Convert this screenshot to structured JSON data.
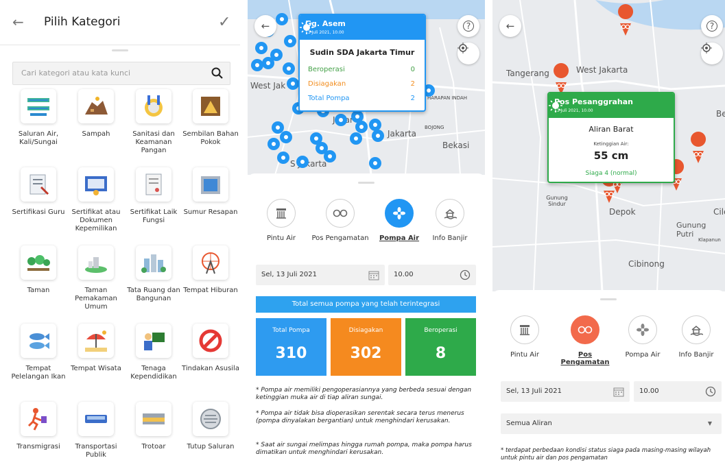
{
  "panel1": {
    "title": "Pilih Kategori",
    "search_placeholder": "Cari kategori atau kata kunci",
    "categories": [
      {
        "label": "Saluran Air, Kali/Sungai",
        "icon": "canal-icon"
      },
      {
        "label": "Sampah",
        "icon": "garbage-pile-icon"
      },
      {
        "label": "Sanitasi dan Keamanan Pangan",
        "icon": "food-safety-icon"
      },
      {
        "label": "Sembilan Bahan Pokok",
        "icon": "staple-food-icon"
      },
      {
        "label": "Sertifikasi Guru",
        "icon": "teacher-certificate-icon"
      },
      {
        "label": "Sertifikat atau Dokumen Kepemilikan",
        "icon": "ownership-certificate-icon"
      },
      {
        "label": "Sertifikat Laik Fungsi",
        "icon": "function-certificate-icon"
      },
      {
        "label": "Sumur Resapan",
        "icon": "infiltration-well-icon"
      },
      {
        "label": "Taman",
        "icon": "park-icon"
      },
      {
        "label": "Taman Pemakaman Umum",
        "icon": "cemetery-icon"
      },
      {
        "label": "Tata Ruang dan Bangunan",
        "icon": "city-planning-icon"
      },
      {
        "label": "Tempat Hiburan",
        "icon": "ferris-wheel-icon"
      },
      {
        "label": "Tempat Pelelangan Ikan",
        "icon": "fish-auction-icon"
      },
      {
        "label": "Tempat Wisata",
        "icon": "beach-umbrella-icon"
      },
      {
        "label": "Tenaga Kependidikan",
        "icon": "educator-icon"
      },
      {
        "label": "Tindakan Asusila",
        "icon": "prohibited-icon"
      },
      {
        "label": "Transmigrasi",
        "icon": "migration-icon"
      },
      {
        "label": "Transportasi Publik",
        "icon": "bus-icon"
      },
      {
        "label": "Trotoar",
        "icon": "sidewalk-icon"
      },
      {
        "label": "Tutup Saluran",
        "icon": "drain-cover-icon"
      }
    ]
  },
  "panel2": {
    "popup": {
      "location": "Gg. Asem",
      "datetime": "13 Juli 2021, 10.00",
      "agency": "Sudin SDA Jakarta Timur",
      "rows": [
        {
          "label": "Beroperasi",
          "value": "0",
          "color": "#43a047"
        },
        {
          "label": "Disiagakan",
          "value": "2",
          "color": "#f28c1c"
        },
        {
          "label": "Total Pompa",
          "value": "2",
          "color": "#2196f3"
        }
      ]
    },
    "map_labels": {
      "west": "West Jak",
      "harapan": "HARAPAN INDAH",
      "bojong": "BOJONG",
      "jakarta": "Jakar",
      "ejakarta": "Jakarta",
      "bekasi": "Bekasi",
      "south": "S  Jakarta"
    },
    "tabs": [
      "Pintu Air",
      "Pos Pengamatan",
      "Pompa Air",
      "Info Banjir"
    ],
    "active_tab": "Pompa Air",
    "date": "Sel, 13 Juli 2021",
    "time": "10.00",
    "banner": "Total semua pompa yang telah terintegrasi",
    "stats": [
      {
        "title": "Total Pompa",
        "value": "310",
        "color": "#2e9bf0"
      },
      {
        "title": "Disiagakan",
        "value": "302",
        "color": "#f58a1f"
      },
      {
        "title": "Beroperasi",
        "value": "8",
        "color": "#2eaa4a"
      }
    ],
    "notes": [
      "* Pompa air memiliki pengoperasiannya yang berbeda sesuai dengan ketinggian muka air di tiap aliran sungai.",
      "* Pompa air tidak bisa dioperasikan serentak secara terus menerus (pompa dinyalakan bergantian) untuk menghindari kerusakan.",
      "* Saat air sungai melimpas hingga rumah pompa, maka pompa harus dimatikan untuk menghindari kerusakan."
    ]
  },
  "panel3": {
    "popup": {
      "location": "Pos Pesanggrahan",
      "datetime": "13 Juli 2021, 10.00",
      "river": "Aliran Barat",
      "level_label": "Ketinggian Air:",
      "level": "55 cm",
      "status": "Siaga 4 (normal)"
    },
    "map_labels": {
      "tangerang": "Tangerang",
      "westjakarta": "West Jakarta",
      "be": "Be",
      "gunungsindur": "Gunung Sindur",
      "depok": "Depok",
      "cile": "Cile",
      "gunungputri": "Gunung Putri",
      "klapanunggal": "Klapanun",
      "cibinong": "Cibinong"
    },
    "tabs": [
      "Pintu Air",
      "Pos Pengamatan",
      "Pompa Air",
      "Info Banjir"
    ],
    "active_tab": "Pos Pengamatan",
    "date": "Sel, 13 Juli 2021",
    "time": "10.00",
    "dropdown": "Semua Aliran",
    "note": "* terdapat perbedaan kondisi status siaga pada masing-masing wilayah untuk pintu air dan pos pengamatan"
  },
  "colors": {
    "blue": "#2196f3",
    "orange": "#f28c1c",
    "green": "#43a047",
    "red_marker": "#e8572f"
  }
}
